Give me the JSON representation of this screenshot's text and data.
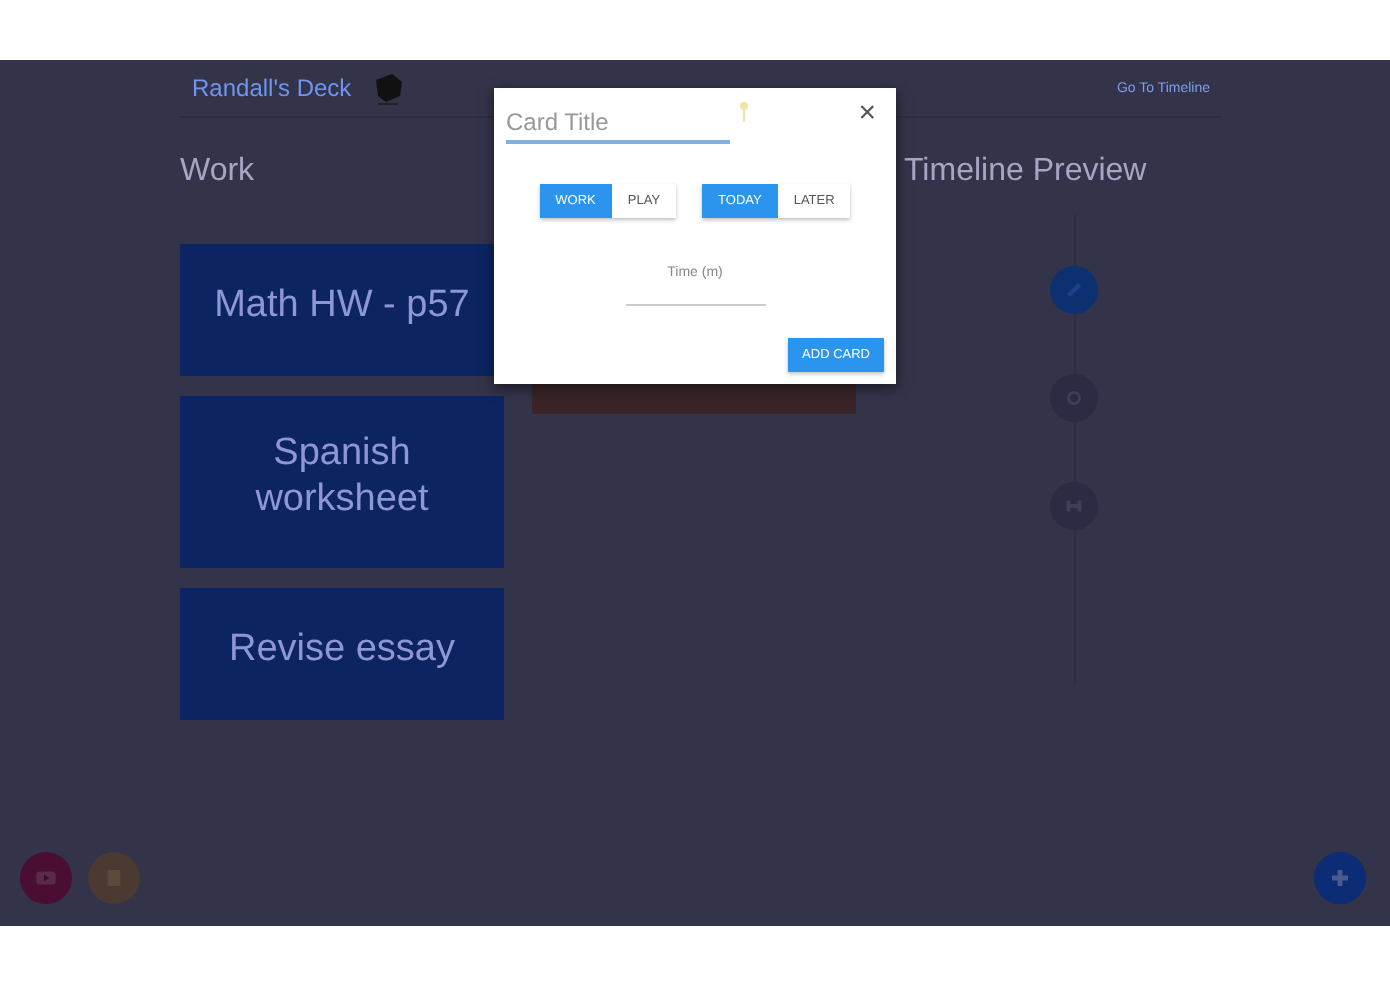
{
  "header": {
    "title": "Randall's Deck",
    "link": "Go To Timeline"
  },
  "work": {
    "heading": "Work",
    "cards": [
      {
        "title": "Math HW - p57"
      },
      {
        "title": "Spanish worksheet"
      },
      {
        "title": "Revise essay"
      }
    ]
  },
  "timeline": {
    "heading": "Timeline Preview"
  },
  "dialog": {
    "title_placeholder": "Card Title",
    "close": "×",
    "toggles": [
      [
        {
          "label": "WORK",
          "selected": true
        },
        {
          "label": "PLAY",
          "selected": false
        }
      ],
      [
        {
          "label": "TODAY",
          "selected": true
        },
        {
          "label": "LATER",
          "selected": false
        }
      ]
    ],
    "time_placeholder": "Time (m)",
    "button": "ADD CARD"
  }
}
